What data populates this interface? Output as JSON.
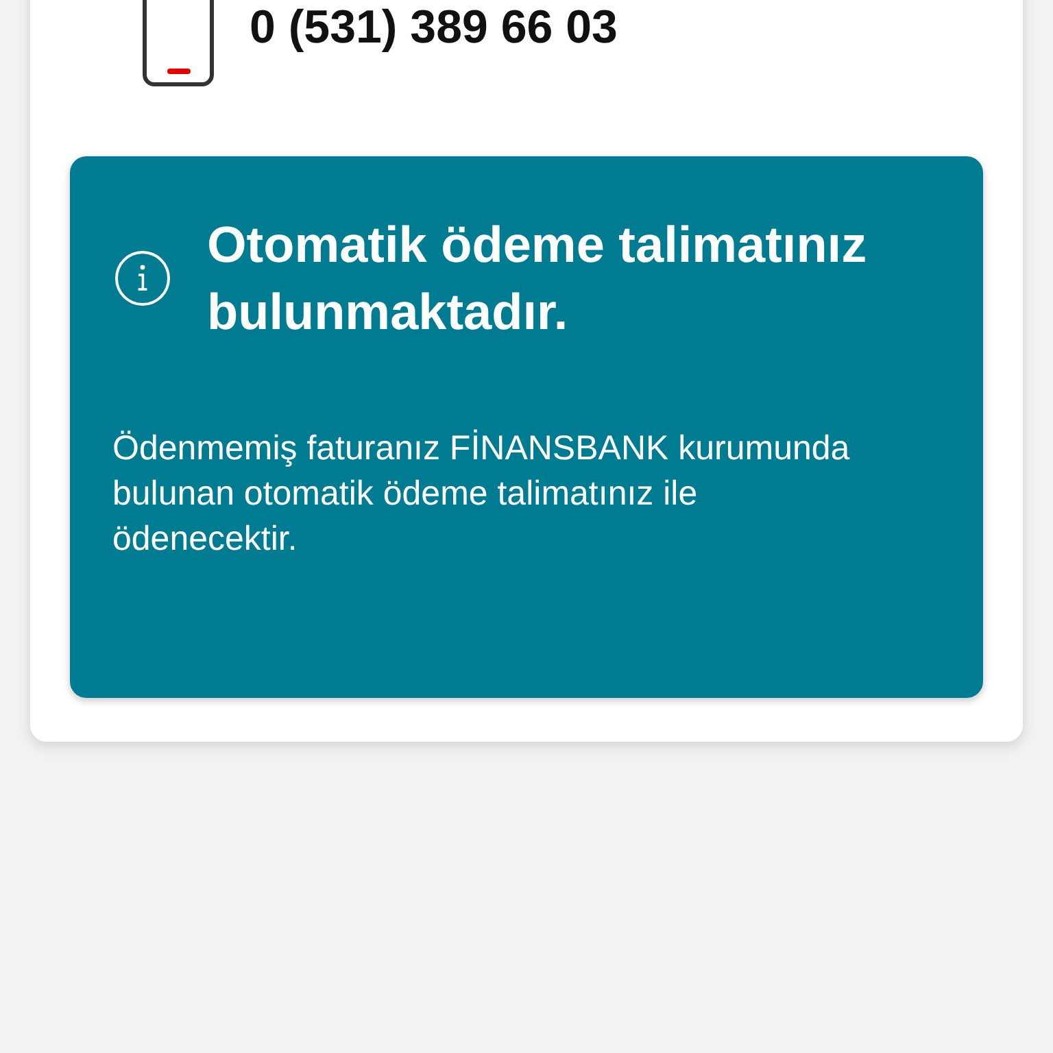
{
  "contact": {
    "phone_number": "0 (531) 389 66 03"
  },
  "notice": {
    "title": "Otomatik ödeme talimatınız bulunmaktadır.",
    "message": "Ödenmemiş faturanız FİNANSBANK kurumunda bulunan otomatik ödeme talimatınız ile ödenecektir."
  }
}
